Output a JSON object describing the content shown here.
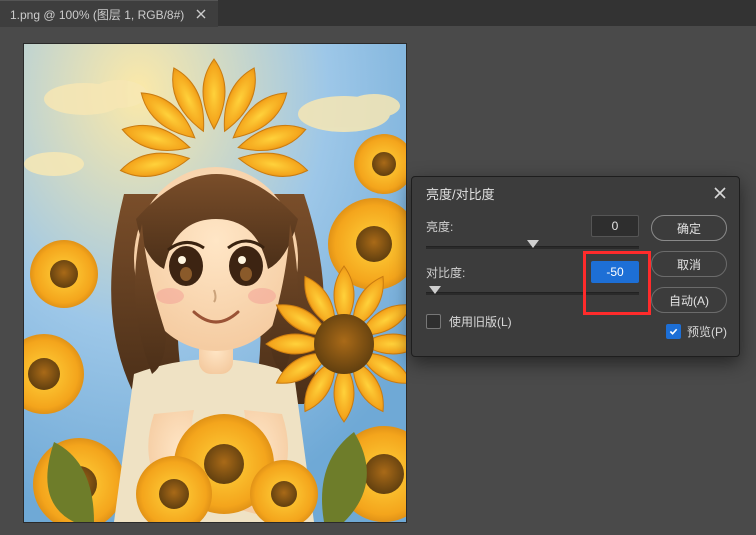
{
  "tab": {
    "title": "1.png @ 100% (图层 1, RGB/8#)"
  },
  "dialog": {
    "title": "亮度/对比度",
    "brightness": {
      "label": "亮度:",
      "value": "0",
      "pos_pct": 50
    },
    "contrast": {
      "label": "对比度:",
      "value": "-50",
      "pos_pct": 4,
      "selected": true,
      "highlight": true
    },
    "legacy": {
      "label": "使用旧版(L)",
      "checked": false
    },
    "buttons": {
      "ok": "确定",
      "cancel": "取消",
      "auto": "自动(A)"
    },
    "preview": {
      "label": "预览(P)",
      "checked": true
    }
  }
}
